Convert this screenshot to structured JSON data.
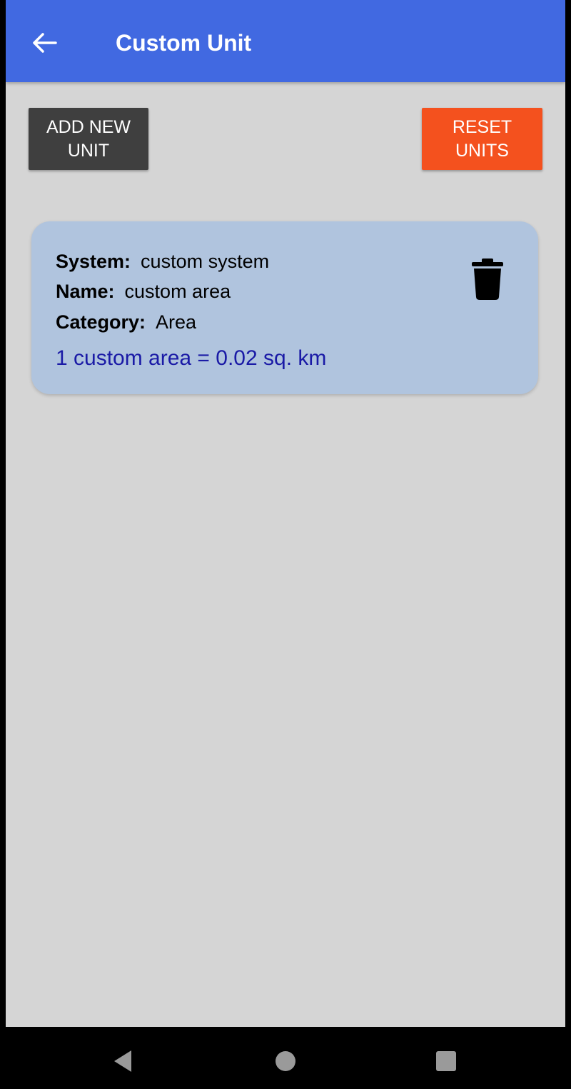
{
  "app_bar": {
    "title": "Custom Unit",
    "back_icon": "arrow-left-icon"
  },
  "actions": {
    "add_label": "ADD NEW\nUNIT",
    "reset_label": "RESET\nUNITS"
  },
  "units": [
    {
      "system_label": "System:",
      "system_value": "custom system",
      "name_label": "Name:",
      "name_value": "custom area",
      "category_label": "Category:",
      "category_value": "Area",
      "formula": "1 custom area = 0.02 sq. km",
      "delete_icon": "trash-icon"
    }
  ],
  "nav": {
    "back_icon": "triangle-back-icon",
    "home_icon": "circle-home-icon",
    "recents_icon": "square-recents-icon"
  },
  "colors": {
    "app_bar": "#4169e1",
    "background": "#d5d5d5",
    "add_button": "#3f3f3f",
    "reset_button": "#f4511e",
    "card": "#b0c4de",
    "formula_text": "#1a1aa6"
  }
}
